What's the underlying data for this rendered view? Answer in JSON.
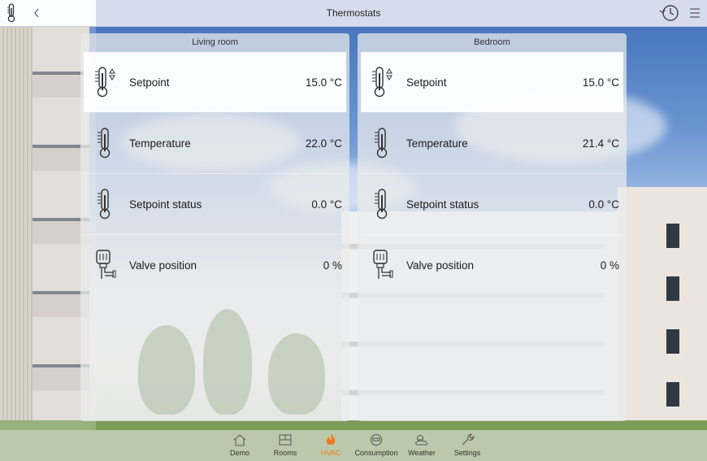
{
  "header": {
    "title": "Thermostats"
  },
  "panels": [
    {
      "title": "Living room",
      "rows": [
        {
          "label": "Setpoint",
          "value": "15.0 °C",
          "icon": "thermometer-setpoint-icon"
        },
        {
          "label": "Temperature",
          "value": "22.0 °C",
          "icon": "thermometer-icon"
        },
        {
          "label": "Setpoint status",
          "value": "0.0 °C",
          "icon": "thermometer-icon"
        },
        {
          "label": "Valve position",
          "value": "0 %",
          "icon": "valve-icon"
        }
      ]
    },
    {
      "title": "Bedroom",
      "rows": [
        {
          "label": "Setpoint",
          "value": "15.0 °C",
          "icon": "thermometer-setpoint-icon"
        },
        {
          "label": "Temperature",
          "value": "21.4 °C",
          "icon": "thermometer-icon"
        },
        {
          "label": "Setpoint status",
          "value": "0.0 °C",
          "icon": "thermometer-icon"
        },
        {
          "label": "Valve position",
          "value": "0 %",
          "icon": "valve-icon"
        }
      ]
    }
  ],
  "nav": [
    {
      "label": "Demo",
      "icon": "home-icon",
      "active": false
    },
    {
      "label": "Rooms",
      "icon": "floorplan-icon",
      "active": false
    },
    {
      "label": "HVAC",
      "icon": "flame-icon",
      "active": true
    },
    {
      "label": "Consumption",
      "icon": "meter-icon",
      "active": false
    },
    {
      "label": "Weather",
      "icon": "cloud-sun-icon",
      "active": false
    },
    {
      "label": "Settings",
      "icon": "wrench-icon",
      "active": false
    }
  ],
  "colors": {
    "accent": "#f07a1a",
    "header_bg": "#e2e5f0"
  }
}
